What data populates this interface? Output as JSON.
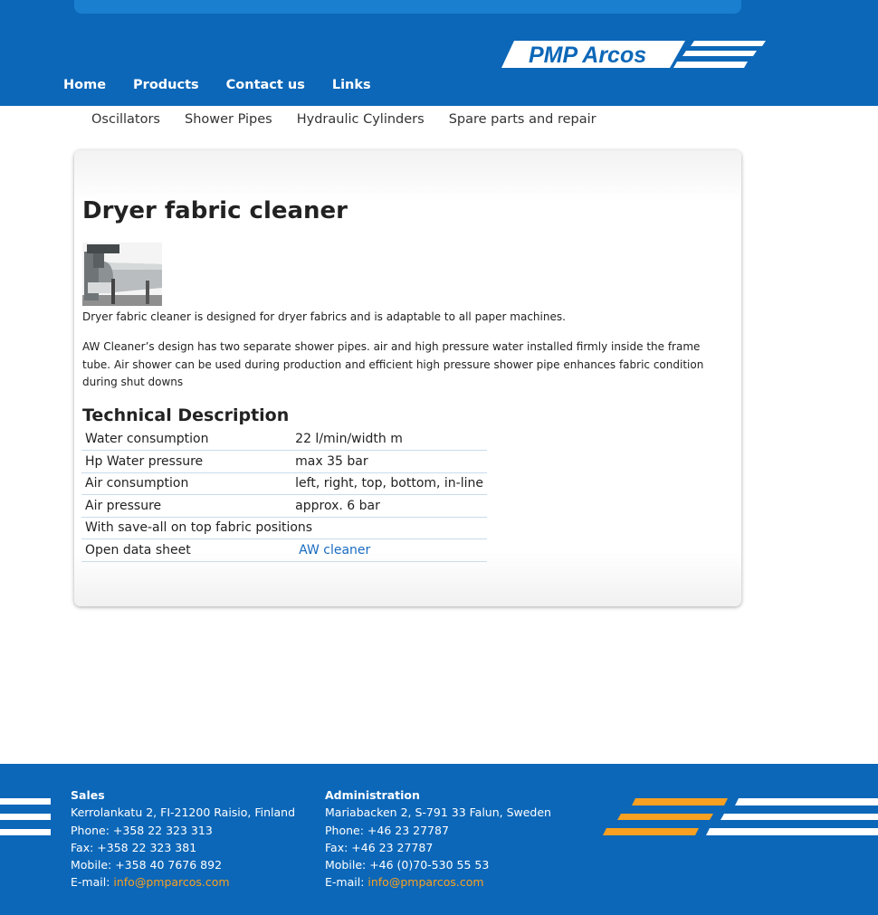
{
  "header": {
    "logo_text": "PMP Arcos",
    "colors": {
      "brand_blue": "#0c67b8",
      "accent_orange": "#f7a021"
    }
  },
  "main_nav": [
    {
      "label": "Home"
    },
    {
      "label": "Products"
    },
    {
      "label": "Contact us"
    },
    {
      "label": "Links"
    }
  ],
  "sub_nav": [
    {
      "label": "Oscillators"
    },
    {
      "label": "Shower Pipes"
    },
    {
      "label": "Hydraulic Cylinders"
    },
    {
      "label": "Spare parts and repair"
    }
  ],
  "main": {
    "title": "Dryer fabric cleaner",
    "image_icon": "product-photo",
    "intro": "Dryer fabric cleaner is designed for dryer fabrics and is adaptable to all paper machines.",
    "description": "AW Cleaner’s design has two separate shower pipes. air and high pressure water installed firmly inside the frame tube. Air shower can be used during production and efficient high pressure shower pipe enhances fabric condition during shut downs",
    "section_title": "Technical Description",
    "specs": [
      {
        "label": "Water consumption",
        "value": "22 l/min/width m"
      },
      {
        "label": "Hp Water pressure",
        "value": "max 35 bar"
      },
      {
        "label": "Air consumption",
        "value": "left, right, top, bottom, in-line"
      },
      {
        "label": "Air pressure",
        "value": "approx. 6 bar"
      },
      {
        "label": "With save-all on top fabric positions",
        "value": ""
      },
      {
        "label": "Open data sheet",
        "link": "AW cleaner"
      }
    ]
  },
  "footer": {
    "sales": {
      "heading": "Sales",
      "address": "Kerrolankatu 2, FI-21200 Raisio, Finland",
      "phone": "Phone: +358 22 323 313",
      "fax": "Fax: +358 22 323 381",
      "mobile": "Mobile: +358 40 7676 892",
      "email_label": "E-mail: ",
      "email": "info@pmparcos.com"
    },
    "administration": {
      "heading": "Administration",
      "address": "Mariabacken 2, S-791 33 Falun, Sweden",
      "phone": "Phone: +46 23 27787",
      "fax": "Fax: +46 23 27787",
      "mobile": "Mobile: +46 (0)70-530 55 53",
      "email_label": "E-mail: ",
      "email": "info@pmparcos.com"
    }
  }
}
